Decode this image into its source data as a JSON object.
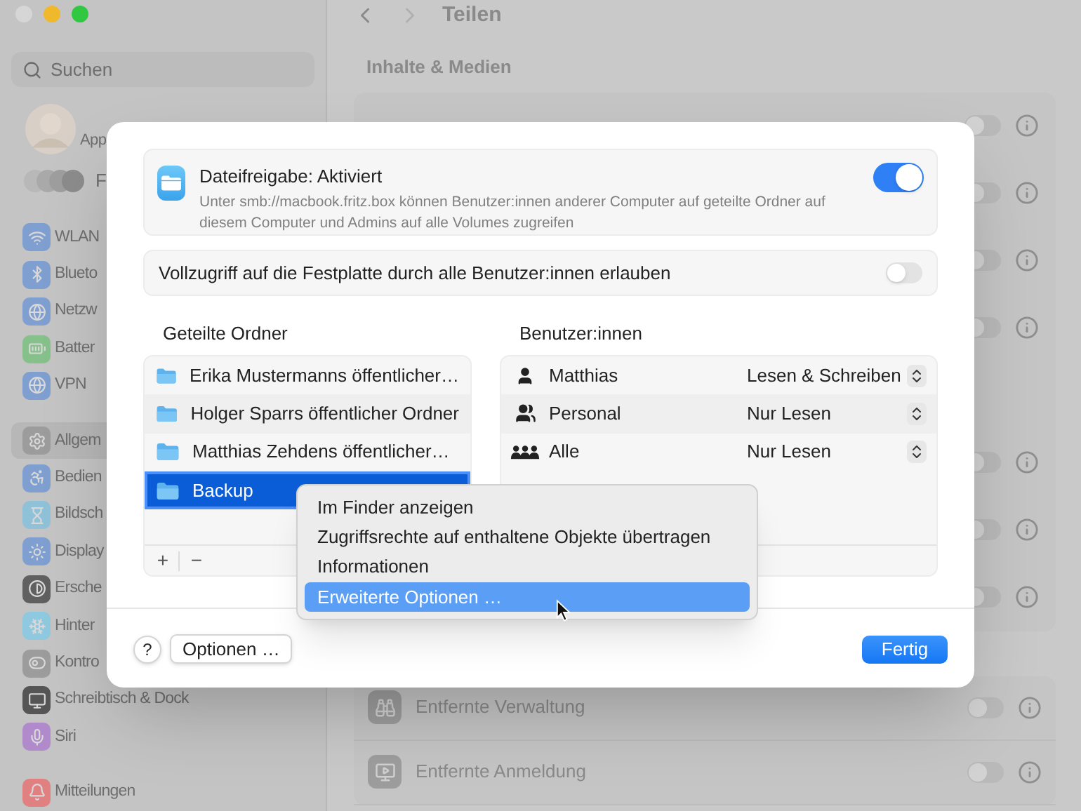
{
  "window": {
    "traffic_lights": [
      {
        "color": "#d6d6d6"
      },
      {
        "color": "#f0b92b"
      },
      {
        "color": "#2fc840"
      }
    ]
  },
  "sidebar": {
    "search": {
      "placeholder": "Suchen"
    },
    "account": {
      "subtitle": "App"
    },
    "family": {
      "label": "F"
    },
    "groups": [
      {
        "items": [
          {
            "label": "WLAN",
            "selected": false,
            "color": "#7f9fd0"
          },
          {
            "label": "Blueto",
            "selected": false,
            "color": "#7f9fd0"
          },
          {
            "label": "Netzw",
            "selected": false,
            "color": "#7f9fd0"
          },
          {
            "label": "Batter",
            "selected": false,
            "color": "#86c08a"
          },
          {
            "label": "VPN",
            "selected": false,
            "color": "#7f9fd0"
          }
        ]
      },
      {
        "items": [
          {
            "label": "Allgem",
            "selected": true,
            "color": "#9c9c9c"
          },
          {
            "label": "Bedien",
            "selected": false,
            "color": "#7f9fd0"
          },
          {
            "label": "Bildsch",
            "selected": false,
            "color": "#8fc1d8"
          },
          {
            "label": "Display",
            "selected": false,
            "color": "#7f9fd0"
          },
          {
            "label": "Ersche",
            "selected": false,
            "color": "#606060"
          },
          {
            "label": "Hinter",
            "selected": false,
            "color": "#8fc9e0"
          },
          {
            "label": "Kontro",
            "selected": false,
            "color": "#9c9c9c"
          },
          {
            "label": "Schreibtisch & Dock",
            "selected": false,
            "color": "#555555"
          },
          {
            "label": "Siri",
            "selected": false,
            "color": "#b08acb"
          }
        ]
      },
      {
        "items": [
          {
            "label": "Mitteilungen",
            "selected": false,
            "color": "#e08080"
          }
        ]
      }
    ]
  },
  "main": {
    "title": "Teilen",
    "section": "Inhalte & Medien",
    "rows": [
      {
        "kind": "toggle",
        "on": false
      },
      {
        "kind": "toggle",
        "on": false
      },
      {
        "kind": "toggle",
        "on": false
      },
      {
        "kind": "toggle",
        "on": false
      },
      {
        "kind": "blank"
      },
      {
        "kind": "toggle",
        "on": false
      },
      {
        "kind": "toggle",
        "on": false
      },
      {
        "kind": "toggle",
        "on": false
      }
    ],
    "advanced_rows": [
      {
        "label": "Entfernte Verwaltung",
        "on": false
      },
      {
        "label": "Entfernte Anmeldung",
        "on": false
      }
    ]
  },
  "sheet": {
    "service": {
      "title": "Dateifreigabe: Aktiviert",
      "description": "Unter smb://macbook.fritz.box können Benutzer:innen anderer Computer auf geteilte Ordner auf diesem Computer und Admins auf alle Volumes zugreifen",
      "on": true
    },
    "full_access": {
      "label": "Vollzugriff auf die Festplatte durch alle Benutzer:innen erlauben",
      "on": false
    },
    "folders": {
      "heading": "Geteilte Ordner",
      "items": [
        {
          "name": "Erika Mustermanns öffentlicher…",
          "selected": false
        },
        {
          "name": "Holger Sparrs öffentlicher Ordner",
          "selected": false
        },
        {
          "name": "Matthias Zehdens öffentlicher…",
          "selected": false
        },
        {
          "name": "Backup",
          "selected": true
        }
      ],
      "add": "+",
      "remove": "−"
    },
    "users": {
      "heading": "Benutzer:innen",
      "items": [
        {
          "name": "Matthias",
          "permission": "Lesen & Schreiben"
        },
        {
          "name": "Personal",
          "permission": "Nur Lesen"
        },
        {
          "name": "Alle",
          "permission": "Nur Lesen"
        }
      ]
    },
    "help": "?",
    "options_button": "Optionen …",
    "done_button": "Fertig"
  },
  "context_menu": {
    "items": [
      {
        "label": "Im Finder anzeigen",
        "selected": false
      },
      {
        "label": "Zugriffsrechte auf enthaltene Objekte übertragen",
        "selected": false
      },
      {
        "label": "Informationen",
        "selected": false
      },
      {
        "label": "Erweiterte Optionen …",
        "selected": true
      }
    ]
  }
}
